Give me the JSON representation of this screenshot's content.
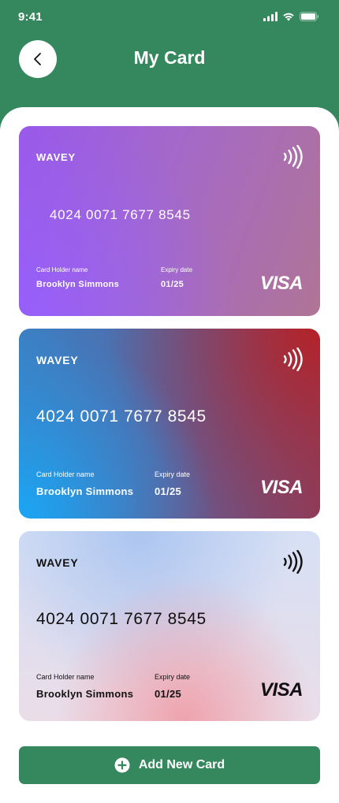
{
  "status_bar": {
    "time": "9:41",
    "icons": [
      "signal-icon",
      "wifi-icon",
      "battery-icon"
    ]
  },
  "header": {
    "back_icon": "chevron-left-icon",
    "title": "My Card"
  },
  "colors": {
    "primary": "#35885d",
    "background": "#ffffff"
  },
  "cards": [
    {
      "brand": "WAVEY",
      "number": "4024 0071 7677 8545",
      "holder_label": "Card Holder name",
      "holder_name": "Brooklyn Simmons",
      "expiry_label": "Expiry date",
      "expiry": "01/25",
      "network": "VISA",
      "contactless_icon": "contactless-icon"
    },
    {
      "brand": "WAVEY",
      "number": "4024 0071 7677 8545",
      "holder_label": "Card Holder name",
      "holder_name": "Brooklyn Simmons",
      "expiry_label": "Expiry date",
      "expiry": "01/25",
      "network": "VISA",
      "contactless_icon": "contactless-icon"
    },
    {
      "brand": "WAVEY",
      "number": "4024 0071 7677 8545",
      "holder_label": "Card Holder name",
      "holder_name": "Brooklyn Simmons",
      "expiry_label": "Expiry date",
      "expiry": "01/25",
      "network": "VISA",
      "contactless_icon": "contactless-icon"
    }
  ],
  "add_button": {
    "icon": "plus-circle-icon",
    "label": "Add New Card"
  }
}
